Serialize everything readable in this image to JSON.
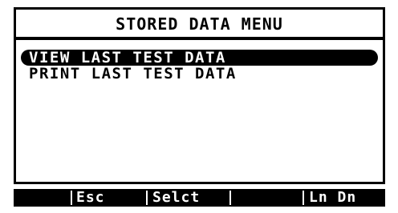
{
  "title": "STORED DATA MENU",
  "menu": {
    "items": [
      {
        "label": "VIEW LAST TEST DATA",
        "selected": true
      },
      {
        "label": "PRINT LAST TEST DATA",
        "selected": false
      }
    ]
  },
  "softkeys": {
    "esc_label": "Esc",
    "select_label": "Selct",
    "line_down_label": "Ln Dn"
  },
  "colors": {
    "foreground": "#000000",
    "background": "#ffffff"
  }
}
